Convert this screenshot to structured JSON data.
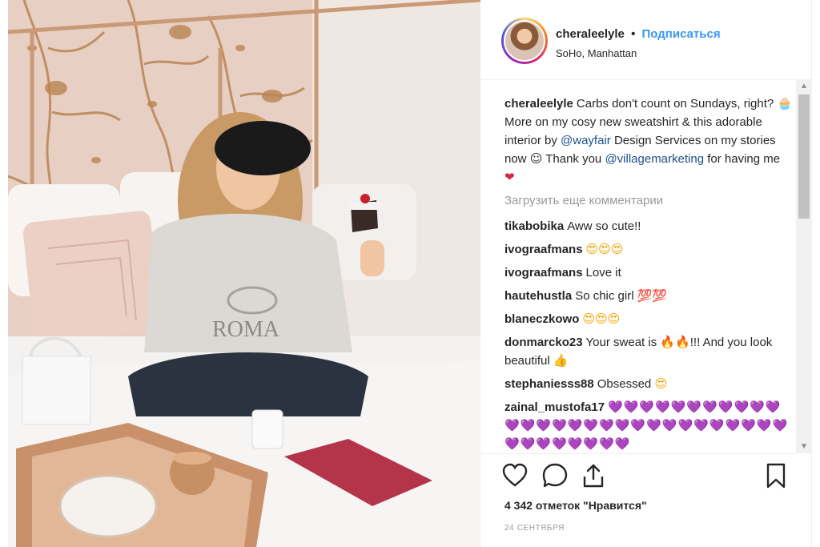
{
  "post": {
    "username": "cheraleelyle",
    "separator": "•",
    "follow_label": "Подписаться",
    "location": "SoHo, Manhattan"
  },
  "caption": {
    "username": "cheraleelyle",
    "part1": "Carbs don't count on Sundays, right? ",
    "emoji1": "🧁",
    "part2": " More on my cosy new sweatshirt & this adorable interior by ",
    "mention1": "@wayfair",
    "part3": " Design Services on my stories now ",
    "emoji2": "☺",
    "part4": " Thank you ",
    "mention2": "@villagemarketing",
    "part5": " for having me ",
    "emoji3": "❤"
  },
  "load_more_label": "Загрузить еще комментарии",
  "comments": [
    {
      "user": "tikabobika",
      "text": "Aww so cute!!",
      "emoji": ""
    },
    {
      "user": "ivograafmans",
      "text": "",
      "emoji": "😍😍😍"
    },
    {
      "user": "ivograafmans",
      "text": "Love it",
      "emoji": ""
    },
    {
      "user": "hautehustla",
      "text": "So chic girl",
      "emoji": "💯💯"
    },
    {
      "user": "blaneczkowo",
      "text": "",
      "emoji": "😍😍😍"
    },
    {
      "user": "donmarcko23",
      "text": "Your sweat is 🔥🔥!!! And you look beautiful 👍",
      "emoji": ""
    },
    {
      "user": "stephaniesss88",
      "text": "Obsessed",
      "emoji": "😍"
    },
    {
      "user": "zainal_mustofa17",
      "text": "",
      "emoji": "💜💜💜💜💜💜💜💜💜💜💜💜💜💜💜💜💜💜💜💜💜💜💜💜💜💜💜💜💜💜💜💜💜💜💜💜💜"
    }
  ],
  "actions": {
    "like_icon": "heart-outline-icon",
    "comment_icon": "speech-bubble-icon",
    "share_icon": "share-arrow-icon",
    "save_icon": "bookmark-icon"
  },
  "likes_label": "4 342 отметок \"Нравится\"",
  "date_label": "24 СЕНТЯБРЯ",
  "colors": {
    "link_blue": "#3897f0",
    "mention_blue": "#1e4e8a",
    "muted_gray": "#999999",
    "text": "#262626"
  }
}
